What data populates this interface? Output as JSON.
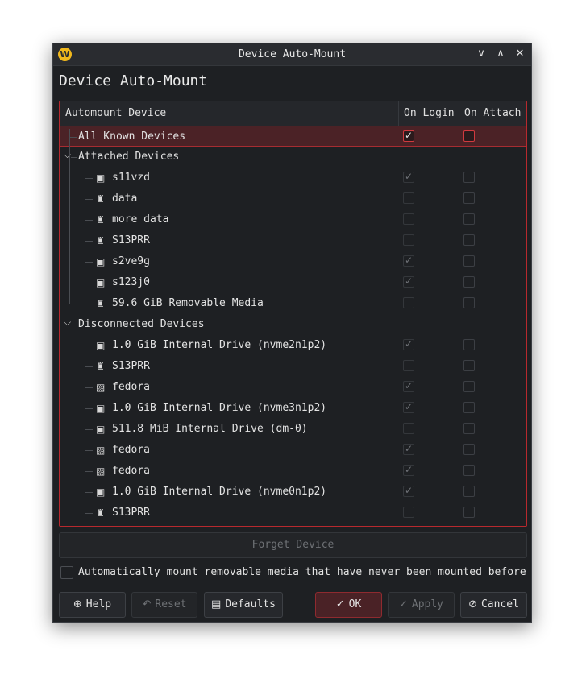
{
  "window": {
    "title": "Device Auto-Mount",
    "heading": "Device Auto-Mount",
    "controls": {
      "minimize": "∨",
      "maximize": "∧",
      "close": "✕"
    }
  },
  "tree": {
    "columns": {
      "device": "Automount Device",
      "login": "On Login",
      "attach": "On Attach"
    },
    "all_known": {
      "label": "All Known Devices",
      "login": true,
      "attach": false
    },
    "attached": {
      "label": "Attached Devices",
      "items": [
        {
          "label": "s11vzd",
          "icon": "drive-icon",
          "login": true,
          "attach": false
        },
        {
          "label": "data",
          "icon": "usb-icon",
          "login": false,
          "attach": false
        },
        {
          "label": "more data",
          "icon": "usb-icon",
          "login": false,
          "attach": false
        },
        {
          "label": "S13PRR",
          "icon": "usb-icon",
          "login": false,
          "attach": false
        },
        {
          "label": "s2ve9g",
          "icon": "drive-icon",
          "login": true,
          "attach": false
        },
        {
          "label": "s123j0",
          "icon": "drive-icon",
          "login": true,
          "attach": false
        },
        {
          "label": "59.6 GiB Removable Media",
          "icon": "usb-icon",
          "login": false,
          "attach": false
        }
      ]
    },
    "disconnected": {
      "label": "Disconnected Devices",
      "items": [
        {
          "label": "1.0 GiB Internal Drive (nvme2n1p2)",
          "icon": "drive-icon",
          "login": true,
          "attach": false
        },
        {
          "label": "S13PRR",
          "icon": "usb-icon",
          "login": false,
          "attach": false
        },
        {
          "label": "fedora",
          "icon": "partition-icon",
          "login": true,
          "attach": false
        },
        {
          "label": "1.0 GiB Internal Drive (nvme3n1p2)",
          "icon": "drive-icon",
          "login": true,
          "attach": false
        },
        {
          "label": "511.8 MiB Internal Drive (dm-0)",
          "icon": "drive-icon",
          "login": false,
          "attach": false
        },
        {
          "label": "fedora",
          "icon": "partition-icon",
          "login": true,
          "attach": false
        },
        {
          "label": "fedora",
          "icon": "partition-icon",
          "login": true,
          "attach": false
        },
        {
          "label": "1.0 GiB Internal Drive (nvme0n1p2)",
          "icon": "drive-icon",
          "login": true,
          "attach": false
        },
        {
          "label": "S13PRR",
          "icon": "usb-icon",
          "login": false,
          "attach": false
        }
      ]
    }
  },
  "forget_label": "Forget Device",
  "auto_mount": {
    "label": "Automatically mount removable media that have never been mounted before",
    "checked": false
  },
  "buttons": {
    "help": "Help",
    "reset": "Reset",
    "defaults": "Defaults",
    "ok": "OK",
    "apply": "Apply",
    "cancel": "Cancel"
  },
  "colors": {
    "accent": "#b8292e",
    "selection": "#4b2226",
    "background": "#1e2023"
  }
}
